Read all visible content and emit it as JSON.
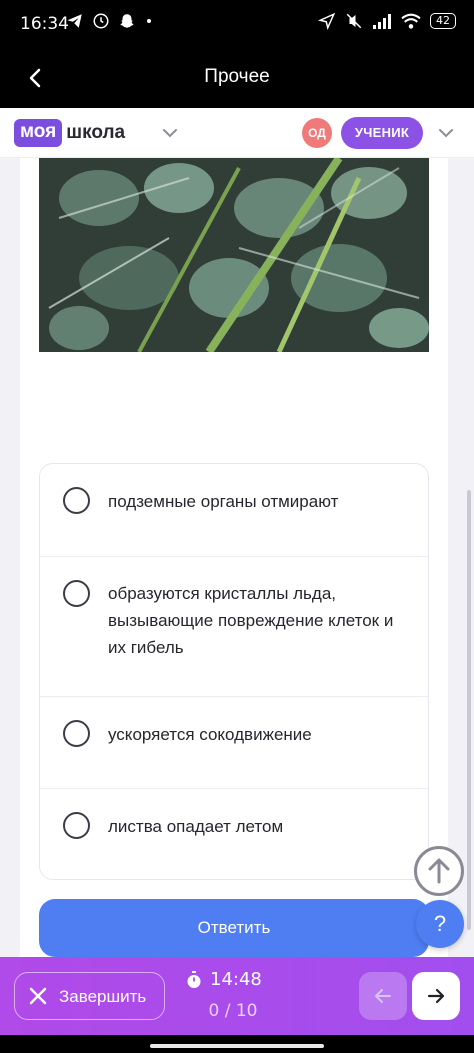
{
  "status_bar": {
    "time": "16:34",
    "battery": "42",
    "left_icons": [
      "telegram-icon",
      "whatsapp-icon",
      "snapchat-icon",
      "dot-icon"
    ],
    "right_icons": [
      "location-icon",
      "mute-icon",
      "signal-icon",
      "wifi-icon",
      "battery-icon"
    ]
  },
  "app_bar": {
    "title": "Прочее"
  },
  "site_header": {
    "logo_part1": "моя",
    "logo_part2": "школа",
    "avatar_initials": "ОД",
    "role_label": "УЧЕНИК"
  },
  "question": {
    "image_icon": "frost-clover-photo",
    "options": [
      {
        "label": "подземные органы отмирают",
        "selected": false
      },
      {
        "label": "образуются кристаллы льда, вызывающие повреждение клеток и их гибель",
        "selected": false
      },
      {
        "label": "ускоряется сокодвижение",
        "selected": false
      },
      {
        "label": "листва опадает летом",
        "selected": false
      }
    ],
    "submit_label": "Ответить",
    "help_label": "?"
  },
  "bottom_bar": {
    "finish_label": "Завершить",
    "timer": "14:48",
    "progress": "0 / 10"
  },
  "colors": {
    "brand_purple": "#7c4ee0",
    "submit_blue": "#4e7ef2",
    "bottom_gradient": "#b04ae8"
  }
}
